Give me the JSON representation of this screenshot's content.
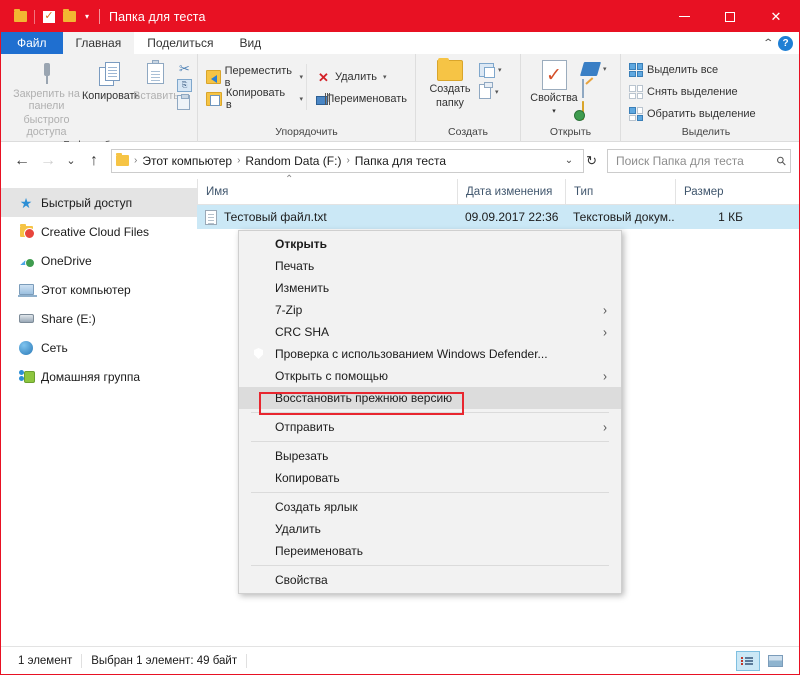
{
  "window": {
    "title": "Папка для теста",
    "qat": [
      {
        "name": "folder-icon",
        "label": "Папка"
      },
      {
        "name": "properties-check-icon",
        "label": "Свойства"
      },
      {
        "name": "new-folder-icon",
        "label": "Создать папку"
      }
    ],
    "caret": "▾",
    "buttons": {
      "minimize": "minimize",
      "maximize": "maximize",
      "close": "✕"
    }
  },
  "tabs": [
    {
      "label": "Файл",
      "kind": "file"
    },
    {
      "label": "Главная",
      "kind": "active"
    },
    {
      "label": "Поделиться",
      "kind": "normal"
    },
    {
      "label": "Вид",
      "kind": "normal"
    }
  ],
  "ribbon_right": {
    "collapse": "⌃",
    "help": "?"
  },
  "ribbon": {
    "groups": [
      {
        "title": "Буфер обмена",
        "big": [
          {
            "label1": "Закрепить на панели",
            "label2": "быстрого доступа",
            "icon": "pin-icon",
            "dim": true
          },
          {
            "label1": "Копировать",
            "label2": "",
            "icon": "copy-icon",
            "dim": false
          },
          {
            "label1": "Вставить",
            "label2": "",
            "icon": "paste-icon",
            "dim": true
          }
        ],
        "minis": [
          {
            "label": "Вырезать",
            "icon": "cut-icon"
          },
          {
            "label": "Копировать путь",
            "icon": "copy-path-icon"
          },
          {
            "label": "Вставить ярлык",
            "icon": "paste-shortcut-icon"
          }
        ]
      },
      {
        "title": "Упорядочить",
        "smalls": [
          {
            "label": "Переместить в",
            "icon": "move-to-icon",
            "caret": "▾"
          },
          {
            "label": "Копировать в",
            "icon": "copy-to-icon",
            "caret": "▾"
          },
          {
            "label": "Удалить",
            "icon": "delete-icon",
            "caret": "▾"
          },
          {
            "label": "Переименовать",
            "icon": "rename-icon",
            "caret": ""
          }
        ]
      },
      {
        "title": "Создать",
        "big": [
          {
            "label1": "Создать",
            "label2": "папку",
            "icon": "new-folder-icon"
          }
        ],
        "minis": [
          {
            "label": "Новый элемент",
            "icon": "new-item-icon",
            "caret": "▾"
          },
          {
            "label": "Простой доступ",
            "icon": "easy-access-icon",
            "caret": "▾"
          }
        ]
      },
      {
        "title": "Открыть",
        "big": [
          {
            "label1": "Свойства",
            "label2": "▾",
            "icon": "properties-icon"
          }
        ],
        "minis": [
          {
            "label": "Открыть",
            "icon": "open-icon",
            "caret": "▾"
          },
          {
            "label": "Изменить",
            "icon": "edit-icon",
            "caret": ""
          },
          {
            "label": "Журнал",
            "icon": "history-icon",
            "caret": ""
          }
        ]
      },
      {
        "title": "Выделить",
        "smalls": [
          {
            "label": "Выделить все",
            "icon": "select-all-icon"
          },
          {
            "label": "Снять выделение",
            "icon": "select-none-icon"
          },
          {
            "label": "Обратить выделение",
            "icon": "invert-selection-icon"
          }
        ]
      }
    ]
  },
  "address": {
    "back": "←",
    "forward": "→",
    "recent": "⌄",
    "up": "↑",
    "crumbs": [
      "Этот компьютер",
      "Random Data (F:)",
      "Папка для теста"
    ],
    "separator": "›",
    "dropdown_caret": "⌄",
    "refresh": "↻"
  },
  "search": {
    "placeholder": "Поиск Папка для теста",
    "value": "",
    "icon": "search-icon"
  },
  "sidebar": {
    "items": [
      {
        "label": "Быстрый доступ",
        "icon": "star-icon",
        "selected": true
      },
      {
        "label": "Creative Cloud Files",
        "icon": "creative-cloud-icon",
        "selected": false
      },
      {
        "label": "OneDrive",
        "icon": "onedrive-icon",
        "selected": false
      },
      {
        "label": "Этот компьютер",
        "icon": "this-pc-icon",
        "selected": false
      },
      {
        "label": "Share (E:)",
        "icon": "drive-icon",
        "selected": false
      },
      {
        "label": "Сеть",
        "icon": "network-icon",
        "selected": false
      },
      {
        "label": "Домашняя группа",
        "icon": "homegroup-icon",
        "selected": false
      }
    ]
  },
  "filelist": {
    "columns": [
      {
        "label": "Имя",
        "key": "name"
      },
      {
        "label": "Дата изменения",
        "key": "date"
      },
      {
        "label": "Тип",
        "key": "type"
      },
      {
        "label": "Размер",
        "key": "size"
      }
    ],
    "sort_caret": "⌃",
    "rows": [
      {
        "name": "Тестовый файл.txt",
        "date": "09.09.2017 22:36",
        "type": "Текстовый докум...",
        "size": "1 КБ",
        "icon": "text-file-icon",
        "selected": true
      }
    ]
  },
  "context_menu": {
    "items": [
      {
        "label": "Открыть",
        "bold": true,
        "arrow": "",
        "icon": "",
        "highlighted": false
      },
      {
        "label": "Печать",
        "bold": false,
        "arrow": "",
        "icon": "",
        "highlighted": false
      },
      {
        "label": "Изменить",
        "bold": false,
        "arrow": "",
        "icon": "",
        "highlighted": false
      },
      {
        "label": "7-Zip",
        "bold": false,
        "arrow": "›",
        "icon": "",
        "highlighted": false
      },
      {
        "label": "CRC SHA",
        "bold": false,
        "arrow": "›",
        "icon": "",
        "highlighted": false
      },
      {
        "label": "Проверка с использованием Windows Defender...",
        "bold": false,
        "arrow": "",
        "icon": "defender-icon",
        "highlighted": false
      },
      {
        "label": "Открыть с помощью",
        "bold": false,
        "arrow": "›",
        "icon": "",
        "highlighted": false
      },
      {
        "label": "Восстановить прежнюю версию",
        "bold": false,
        "arrow": "",
        "icon": "",
        "highlighted": true
      },
      {
        "separator": true
      },
      {
        "label": "Отправить",
        "bold": false,
        "arrow": "›",
        "icon": "",
        "highlighted": false
      },
      {
        "separator": true
      },
      {
        "label": "Вырезать",
        "bold": false,
        "arrow": "",
        "icon": "",
        "highlighted": false
      },
      {
        "label": "Копировать",
        "bold": false,
        "arrow": "",
        "icon": "",
        "highlighted": false
      },
      {
        "separator": true
      },
      {
        "label": "Создать ярлык",
        "bold": false,
        "arrow": "",
        "icon": "",
        "highlighted": false
      },
      {
        "label": "Удалить",
        "bold": false,
        "arrow": "",
        "icon": "",
        "highlighted": false
      },
      {
        "label": "Переименовать",
        "bold": false,
        "arrow": "",
        "icon": "",
        "highlighted": false
      },
      {
        "separator": true
      },
      {
        "label": "Свойства",
        "bold": false,
        "arrow": "",
        "icon": "",
        "highlighted": false
      }
    ],
    "highlight_color": "#e8262f"
  },
  "statusbar": {
    "item_count": "1 элемент",
    "selection": "Выбран 1 элемент: 49 байт",
    "views": [
      {
        "name": "details-view-button",
        "active": true
      },
      {
        "name": "large-icons-view-button",
        "active": false
      }
    ]
  }
}
